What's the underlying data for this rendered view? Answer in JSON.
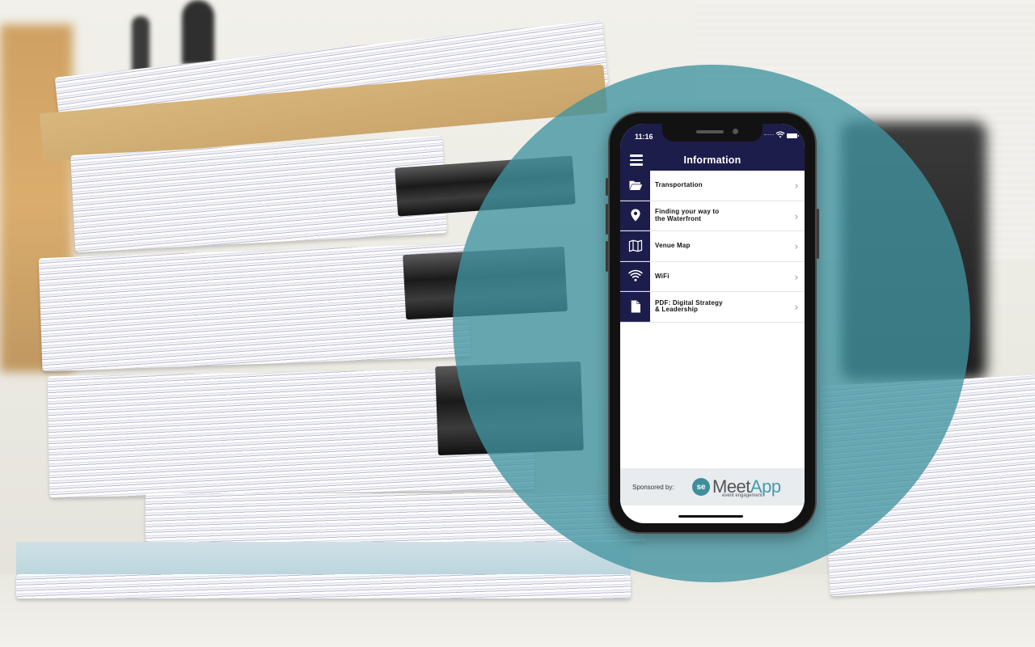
{
  "phone": {
    "status_bar": {
      "time": "11:16"
    },
    "nav": {
      "title": "Information",
      "menu_icon": "hamburger-icon"
    },
    "menu_items": [
      {
        "label": "Transportation",
        "icon": "folder-open-icon"
      },
      {
        "label": "Finding your way to\nthe Waterfront",
        "icon": "map-pin-icon"
      },
      {
        "label": "Venue Map",
        "icon": "map-icon"
      },
      {
        "label": "WiFi",
        "icon": "wifi-icon"
      },
      {
        "label": "PDF: Digital Strategy\n& Leadership",
        "icon": "document-icon"
      }
    ],
    "chevron": "›",
    "sponsor": {
      "label": "Sponsored by:",
      "logo_mark": "se",
      "logo_meet": "Meet",
      "logo_app": "App",
      "logo_tagline": "event engagement"
    }
  },
  "colors": {
    "nav_bg": "#1d1d4b",
    "accent_teal": "#4094a0",
    "sponsor_bg": "#e8ecef"
  }
}
